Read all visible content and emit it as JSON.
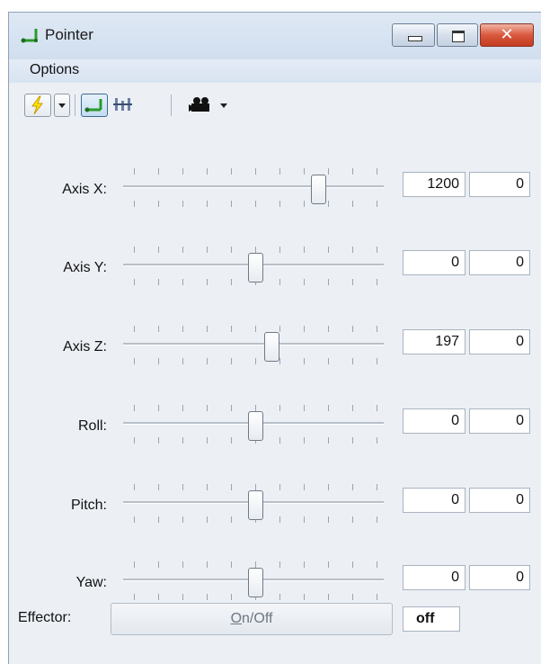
{
  "window": {
    "title": "Pointer"
  },
  "menu": {
    "items": [
      {
        "label": "Options"
      }
    ]
  },
  "toolbar": {
    "buttons": [
      {
        "icon": "lightning-icon"
      },
      {
        "icon": "chevron-down-icon"
      },
      {
        "icon": "pointer-axes-icon",
        "pressed": true
      },
      {
        "icon": "axes-alt-icon"
      },
      {
        "icon": "camera-icon"
      },
      {
        "icon": "chevron-down-icon"
      }
    ]
  },
  "axes": [
    {
      "label": "Axis X:",
      "value": "1200",
      "value2": "0",
      "position": 0.76
    },
    {
      "label": "Axis Y:",
      "value": "0",
      "value2": "0",
      "position": 0.5
    },
    {
      "label": "Axis Z:",
      "value": "197",
      "value2": "0",
      "position": 0.565
    },
    {
      "label": "Roll:",
      "value": "0",
      "value2": "0",
      "position": 0.5
    },
    {
      "label": "Pitch:",
      "value": "0",
      "value2": "0",
      "position": 0.5
    },
    {
      "label": "Yaw:",
      "value": "0",
      "value2": "0",
      "position": 0.5
    }
  ],
  "effector": {
    "label": "Effector:",
    "button_mnemonic": "O",
    "button_rest": "n/Off",
    "state": "off"
  },
  "colors": {
    "window_bg": "#ecf0f5",
    "close_red": "#c23c1f",
    "pointer_green": "#2a9a2a"
  }
}
